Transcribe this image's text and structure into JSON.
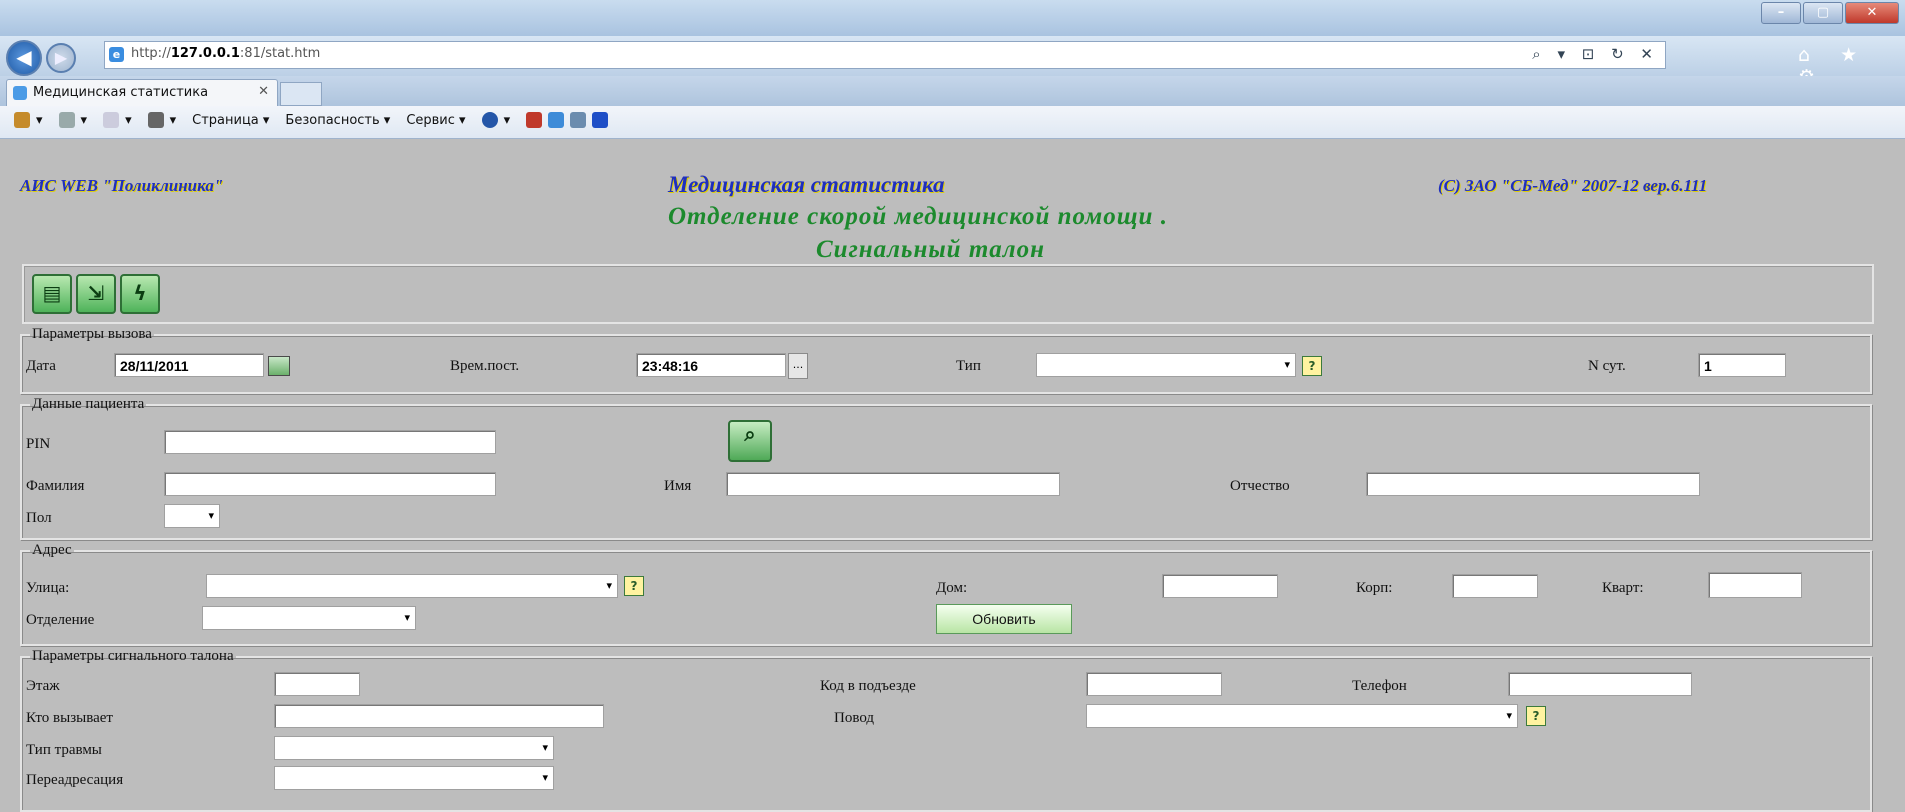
{
  "browser": {
    "url_prefix": "http://",
    "url_host": "127.0.0.1",
    "url_path": ":81/stat.htm",
    "address_tools": "⌕ ▾ ⊡ ↻ ✕",
    "window_controls": [
      "–",
      "▢",
      "✕"
    ],
    "right_icons": "⌂ ★ ⚙",
    "tab_title": "Медицинская статистика",
    "tab_close": "✕",
    "commands": [
      "Страница ▾",
      "Безопасность ▾",
      "Сервис ▾"
    ]
  },
  "header": {
    "left": "АИС WEB \"Поликлиника\"",
    "center": "Медицинская статистика",
    "right": "(С) ЗАО \"СБ-Мед\" 2007-12 вер.6.111",
    "subtitle1": "Отделение скорой медицинской помощи .",
    "subtitle2": "Сигнальный талон"
  },
  "toolbar": {
    "buttons": [
      "print-icon",
      "exit-icon",
      "lightning-icon"
    ]
  },
  "call_params": {
    "legend": "Параметры вызова",
    "date_label": "Дата",
    "date_value": "28/11/2011",
    "time_label": "Врем.пост.",
    "time_value": "23:48:16",
    "type_label": "Тип",
    "type_value": "",
    "day_no_label": "N сут.",
    "day_no_value": "1"
  },
  "patient": {
    "legend": "Данные пациента",
    "pin_label": "PIN",
    "surname_label": "Фамилия",
    "name_label": "Имя",
    "patronymic_label": "Отчество",
    "sex_label": "Пол"
  },
  "address": {
    "legend": "Адрес",
    "street_label": "Улица:",
    "house_label": "Дом:",
    "building_label": "Корп:",
    "apt_label": "Кварт:",
    "department_label": "Отделение",
    "update_button": "Обновить"
  },
  "ticket": {
    "legend": "Параметры сигнального талона",
    "floor_label": "Этаж",
    "door_code_label": "Код в подъезде",
    "phone_label": "Телефон",
    "caller_label": "Кто вызывает",
    "reason_label": "Повод",
    "injury_label": "Тип травмы",
    "redirect_label": "Переадресация"
  },
  "glyphs": {
    "help": "?",
    "dots": "...",
    "arrow": "▾"
  }
}
